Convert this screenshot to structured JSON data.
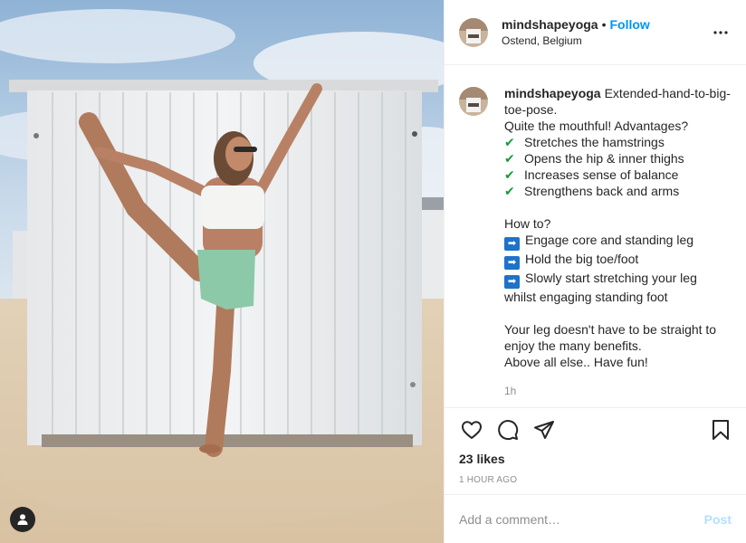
{
  "colors": {
    "link": "#0095f6",
    "post_disabled": "#b2dffc",
    "secondary_text": "#8e8e8e",
    "check_green": "#1a9b3c",
    "arrow_blue": "#1e73c9"
  },
  "photo": {
    "alt_subject": "yoga-pose-photo"
  },
  "header": {
    "username": "mindshapeyoga",
    "separator": "•",
    "follow_label": "Follow",
    "location": "Ostend, Belgium",
    "more_icon": "more-horizontal-icon"
  },
  "caption": {
    "username": "mindshapeyoga",
    "first_line": "Extended-hand-to-big-toe-pose.",
    "intro": "Quite the mouthful! Advantages?",
    "advantages": [
      "Stretches the hamstrings",
      "Opens the hip & inner thighs",
      "Increases sense of balance",
      "Strengthens back and arms"
    ],
    "howto_title": "How to?",
    "steps": [
      "Engage core and standing leg",
      "Hold the big toe/foot",
      "Slowly start stretching your leg whilst engaging standing foot"
    ],
    "closing_1": "Your leg doesn't have to be straight to enjoy the many benefits.",
    "closing_2": "Above all else.. Have fun!",
    "time_ago": "1h",
    "check_glyph": "✔",
    "arrow_glyph": "➡"
  },
  "actions": {
    "like_icon": "heart-icon",
    "comment_icon": "comment-icon",
    "share_icon": "share-icon",
    "save_icon": "bookmark-icon",
    "likes": "23 likes",
    "posted_ago": "1 HOUR AGO"
  },
  "comment_box": {
    "placeholder": "Add a comment…",
    "post_label": "Post"
  }
}
